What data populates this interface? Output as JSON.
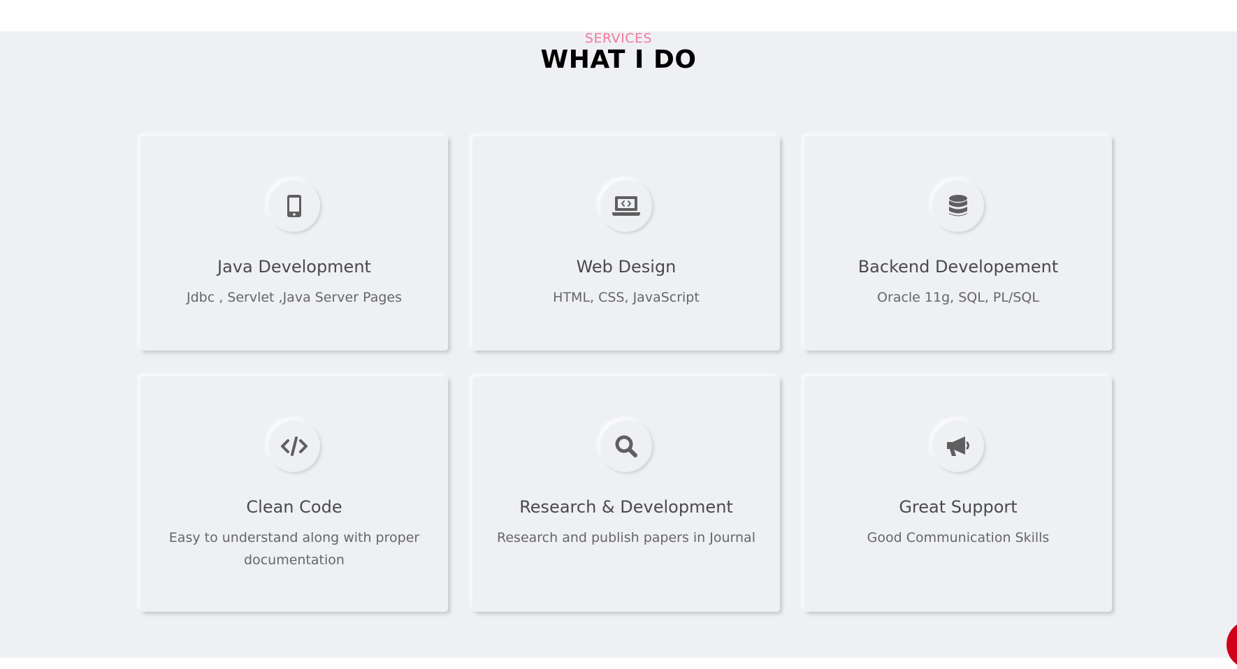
{
  "colors": {
    "accent": "#f27a9b",
    "background": "#eef0f4",
    "icon": "#5f5f5f",
    "fab": "#d0021b"
  },
  "section": {
    "eyebrow": "SERVICES",
    "heading": "WHAT I DO"
  },
  "cards": [
    {
      "icon": "mobile-icon",
      "title": "Java Development",
      "description": "Jdbc , Servlet ,Java Server Pages"
    },
    {
      "icon": "laptop-code-icon",
      "title": "Web Design",
      "description": "HTML, CSS, JavaScript"
    },
    {
      "icon": "database-icon",
      "title": "Backend Developement",
      "description": "Oracle 11g, SQL, PL/SQL"
    },
    {
      "icon": "code-icon",
      "title": "Clean Code",
      "description": "Easy to understand along with proper documentation"
    },
    {
      "icon": "search-icon",
      "title": "Research & Development",
      "description": "Research and publish papers in Journal"
    },
    {
      "icon": "megaphone-icon",
      "title": "Great Support",
      "description": "Good Communication Skills"
    }
  ]
}
